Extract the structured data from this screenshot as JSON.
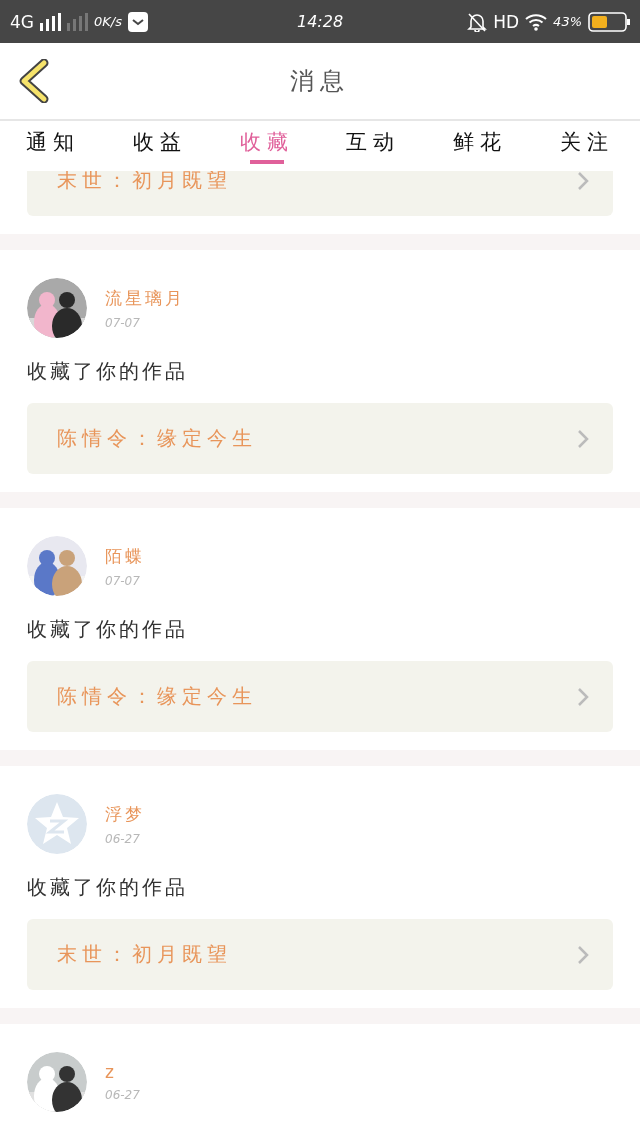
{
  "status_bar": {
    "network": "4G",
    "speed": "0K/s",
    "time": "14:28",
    "hd": "HD",
    "battery": "43%"
  },
  "header": {
    "title": "消息"
  },
  "tabs": [
    {
      "label": "通知",
      "selected": false
    },
    {
      "label": "收益",
      "selected": false
    },
    {
      "label": "收藏",
      "selected": true
    },
    {
      "label": "互动",
      "selected": false
    },
    {
      "label": "鲜花",
      "selected": false
    },
    {
      "label": "关注",
      "selected": false
    }
  ],
  "partial_item": {
    "work": "末世：初月既望"
  },
  "items": [
    {
      "name": "流星璃月",
      "date": "07-07",
      "action": "收藏了你的作品",
      "work": "陈情令：缘定今生"
    },
    {
      "name": "陌蝶",
      "date": "07-07",
      "action": "收藏了你的作品",
      "work": "陈情令：缘定今生"
    },
    {
      "avatar": {
        "kind": "default"
      },
      "name": "浮梦",
      "date": "06-27",
      "action": "收藏了你的作品",
      "work": "末世：初月既望"
    },
    {
      "name": "z",
      "date": "06-27"
    }
  ]
}
